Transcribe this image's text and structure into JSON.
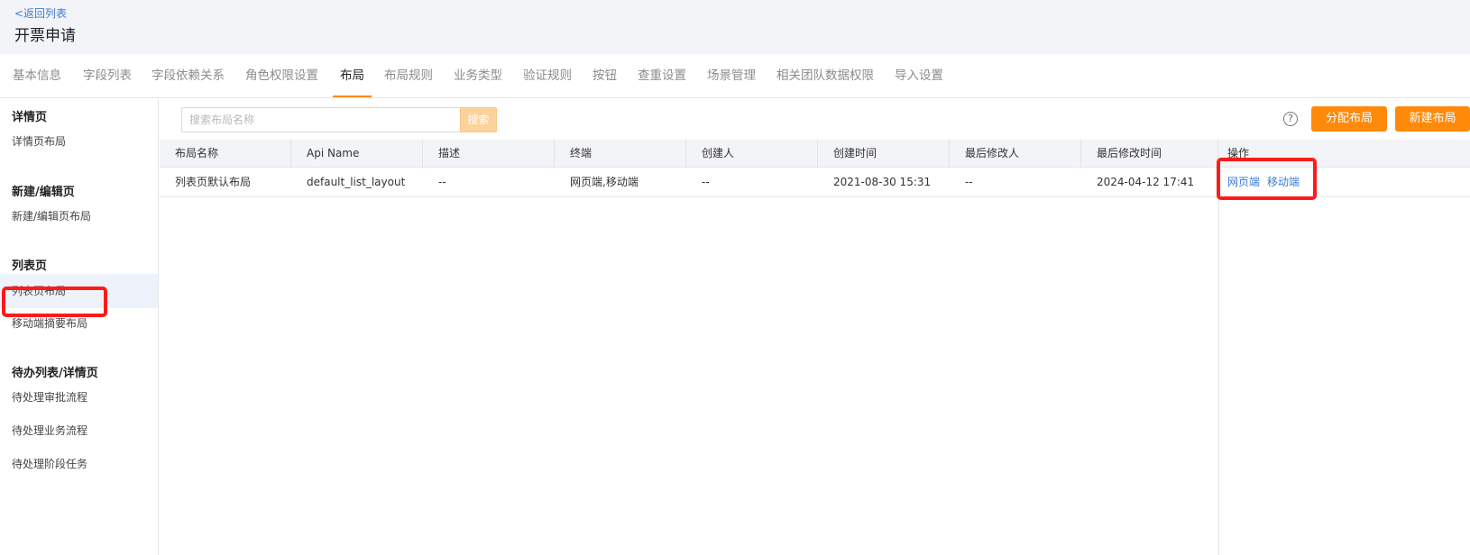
{
  "header": {
    "back_label": "<返回列表",
    "title": "开票申请"
  },
  "tabs": [
    {
      "label": "基本信息"
    },
    {
      "label": "字段列表"
    },
    {
      "label": "字段依赖关系"
    },
    {
      "label": "角色权限设置"
    },
    {
      "label": "布局",
      "active": true
    },
    {
      "label": "布局规则"
    },
    {
      "label": "业务类型"
    },
    {
      "label": "验证规则"
    },
    {
      "label": "按钮"
    },
    {
      "label": "查重设置"
    },
    {
      "label": "场景管理"
    },
    {
      "label": "相关团队数据权限"
    },
    {
      "label": "导入设置"
    }
  ],
  "sidebar": {
    "sections": [
      {
        "heading": "详情页",
        "items": [
          {
            "label": "详情页布局"
          }
        ]
      },
      {
        "heading": "新建/编辑页",
        "items": [
          {
            "label": "新建/编辑页布局"
          }
        ]
      },
      {
        "heading": "列表页",
        "items": [
          {
            "label": "列表页布局",
            "active": true
          },
          {
            "label": "移动端摘要布局"
          }
        ]
      },
      {
        "heading": "待办列表/详情页",
        "items": [
          {
            "label": "待处理审批流程"
          },
          {
            "label": "待处理业务流程"
          },
          {
            "label": "待处理阶段任务"
          }
        ]
      }
    ]
  },
  "toolbar": {
    "search_placeholder": "搜索布局名称",
    "search_button": "搜索",
    "help_icon": "?",
    "assign_layout_button": "分配布局",
    "new_layout_button": "新建布局"
  },
  "table": {
    "columns": [
      "布局名称",
      "Api Name",
      "描述",
      "终端",
      "创建人",
      "创建时间",
      "最后修改人",
      "最后修改时间",
      "操作"
    ],
    "rows": [
      {
        "cells": [
          "列表页默认布局",
          "default_list_layout",
          "--",
          "网页端,移动端",
          "--",
          "2021-08-30 15:31",
          "--",
          "2024-04-12 17:41"
        ],
        "actions": [
          "网页端",
          "移动端"
        ]
      }
    ]
  },
  "colors": {
    "accent": "#ff8a0a",
    "link": "#3a7bd5",
    "highlight": "#ff1a1a"
  }
}
